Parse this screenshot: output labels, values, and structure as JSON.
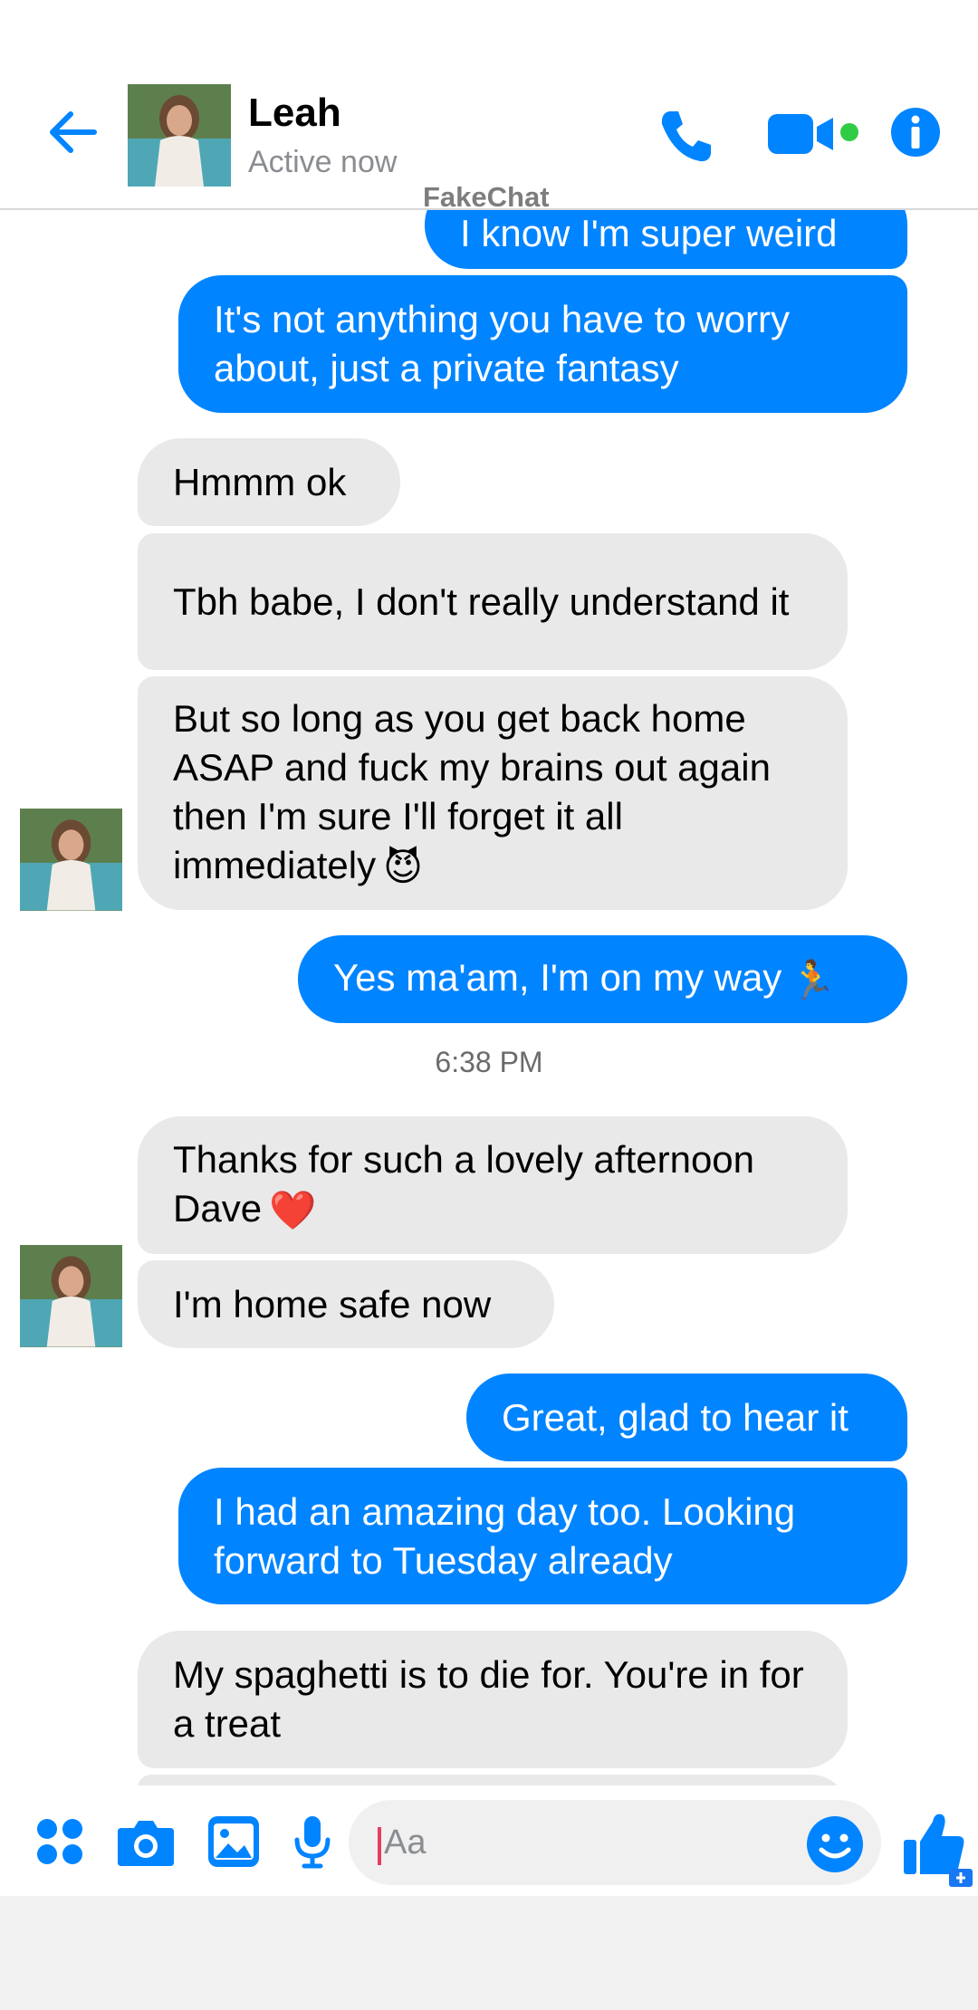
{
  "header": {
    "contact_name": "Leah",
    "status": "Active now",
    "watermark": "FakeChat"
  },
  "messages": [
    {
      "side": "out",
      "text": "I know I'm super weird"
    },
    {
      "side": "out",
      "text": "It's not anything you have to worry about, just a private fantasy"
    },
    {
      "side": "in",
      "text": "Hmmm ok"
    },
    {
      "side": "in",
      "text": "Tbh babe, I don't really understand it"
    },
    {
      "side": "in",
      "text": "But so long as you get back home ASAP and fuck my brains out again then I'm sure I'll forget it all immediately",
      "emoji": "😈"
    },
    {
      "side": "out",
      "text": "Yes ma'am, I'm on my way",
      "emoji": "🏃"
    },
    {
      "side": "in",
      "text": "Thanks for such a lovely afternoon Dave",
      "emoji": "❤️"
    },
    {
      "side": "in",
      "text": "I'm home safe now"
    },
    {
      "side": "out",
      "text": "Great, glad to hear it"
    },
    {
      "side": "out",
      "text": "I had an amazing day too. Looking forward to Tuesday already"
    },
    {
      "side": "in",
      "text": "My spaghetti is to die for. You're in for a treat"
    }
  ],
  "timestamp": "6:38 PM",
  "composer": {
    "placeholder": "Aa"
  },
  "colors": {
    "accent": "#0084ff",
    "incoming_bubble": "#e9e9e9",
    "online": "#31cc46"
  },
  "icons": [
    "back-arrow-icon",
    "phone-icon",
    "video-camera-icon",
    "info-icon",
    "apps-grid-icon",
    "camera-icon",
    "gallery-icon",
    "microphone-icon",
    "emoji-icon",
    "thumbs-up-icon"
  ]
}
